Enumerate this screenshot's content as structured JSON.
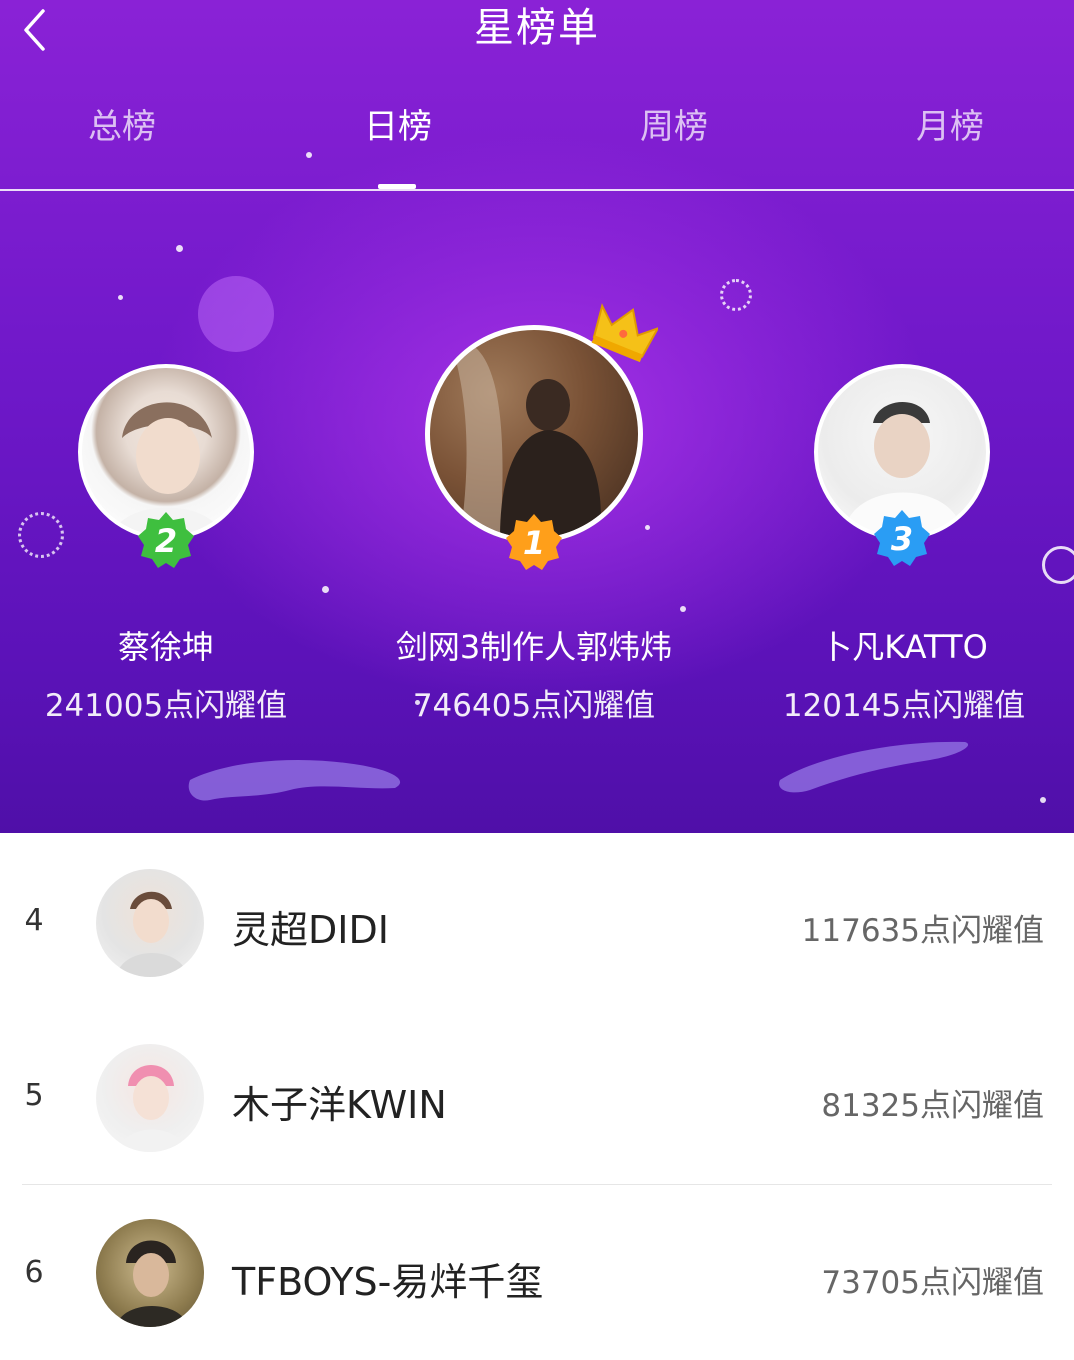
{
  "header": {
    "title": "星榜单",
    "back_icon": "chevron-left-icon"
  },
  "tabs": [
    {
      "label": "总榜",
      "active": false
    },
    {
      "label": "日榜",
      "active": true
    },
    {
      "label": "周榜",
      "active": false
    },
    {
      "label": "月榜",
      "active": false
    }
  ],
  "podium": {
    "first": {
      "rank": "1",
      "name": "剑网3制作人郭炜炜",
      "score": "746405点闪耀值",
      "badge_color": "#ff9f1a"
    },
    "second": {
      "rank": "2",
      "name": "蔡徐坤",
      "score": "241005点闪耀值",
      "badge_color": "#3fbf3f"
    },
    "third": {
      "rank": "3",
      "name": "卜凡KATTO",
      "score": "120145点闪耀值",
      "badge_color": "#2a9df4"
    }
  },
  "list": [
    {
      "rank": "4",
      "name": "灵超DIDI",
      "score": "117635点闪耀值"
    },
    {
      "rank": "5",
      "name": "木子洋KWIN",
      "score": "81325点闪耀值"
    },
    {
      "rank": "6",
      "name": "TFBOYS-易烊千玺",
      "score": "73705点闪耀值"
    }
  ],
  "colors": {
    "hero_top": "#8a22d6",
    "hero_bottom": "#4f0fa8",
    "gold": "#f5b400"
  }
}
